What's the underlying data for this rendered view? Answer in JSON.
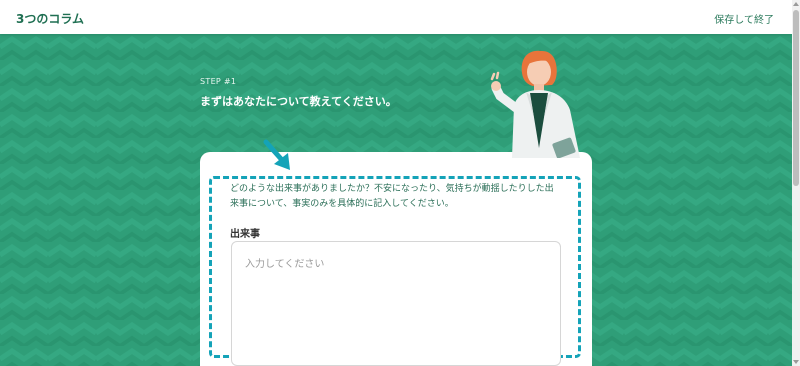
{
  "header": {
    "app_title": "3つのコラム",
    "save_exit_label": "保存して終了"
  },
  "step": {
    "label": "STEP #1",
    "title": "まずはあなたについて教えてください。"
  },
  "form": {
    "instruction": "どのような出来事がありましたか？不安になったり、気持ちが動揺したりした出来事について、事実のみを具体的に記入してください。",
    "field_label": "出来事",
    "field_placeholder": "入力してください",
    "field_value": ""
  },
  "colors": {
    "background": "#2f9e78",
    "accent": "#14a3b8",
    "title": "#1f6f52"
  },
  "icons": {
    "arrow": "arrow-down-right-icon",
    "illustration": "counselor-illustration"
  }
}
